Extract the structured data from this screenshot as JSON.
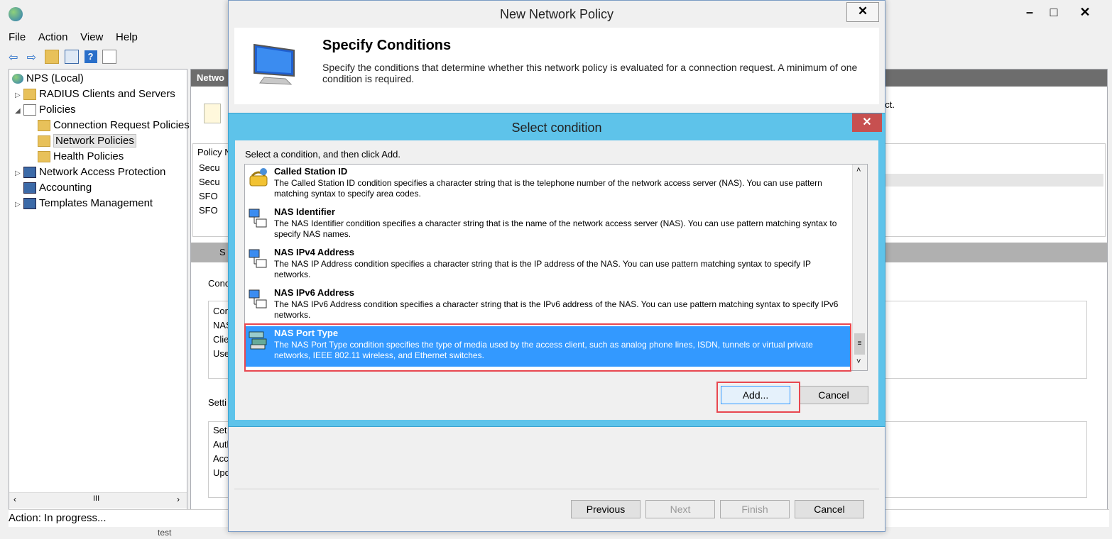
{
  "mmc": {
    "menu": [
      "File",
      "Action",
      "View",
      "Help"
    ],
    "tree": [
      {
        "label": "NPS (Local)"
      },
      {
        "label": "RADIUS Clients and Servers"
      },
      {
        "label": "Policies"
      },
      {
        "label": "Connection Request Policies"
      },
      {
        "label": "Network Policies"
      },
      {
        "label": "Health Policies"
      },
      {
        "label": "Network Access Protection"
      },
      {
        "label": "Accounting"
      },
      {
        "label": "Templates Management"
      }
    ],
    "right_pane": {
      "header_partial": "Netwo",
      "policy_col": "Policy N",
      "rows": [
        "Secu",
        "Secu",
        "SFO",
        "SFO"
      ],
      "selected_header_partial": "S",
      "conditions_label": "Cond",
      "conditions_rows": [
        "Con",
        "NAS",
        "Clie",
        "Use"
      ],
      "settings_label": "Setti",
      "settings_rows": [
        "Set",
        "Auth",
        "Acc",
        "Upd"
      ],
      "side_text": "ect."
    },
    "status": "Action:  In progress...",
    "bottom_partial": "test"
  },
  "wizard": {
    "title": "New Network Policy",
    "heading": "Specify Conditions",
    "description": "Specify the conditions that determine whether this network policy is evaluated for a connection request. A minimum of one condition is required.",
    "buttons": {
      "previous": "Previous",
      "next": "Next",
      "finish": "Finish",
      "cancel": "Cancel"
    }
  },
  "dialog": {
    "title": "Select condition",
    "instruction": "Select a condition, and then click Add.",
    "items": [
      {
        "name": "Called Station ID",
        "description": "The Called Station ID condition specifies a character string that is the telephone number of the network access server (NAS). You can use pattern matching syntax to specify area codes."
      },
      {
        "name": "NAS Identifier",
        "description": "The NAS Identifier condition specifies a character string that is the name of the network access server (NAS). You can use pattern matching syntax to specify NAS names."
      },
      {
        "name": "NAS IPv4 Address",
        "description": "The NAS IP Address condition specifies a character string that is the IP address of the NAS. You can use pattern matching syntax to specify IP networks."
      },
      {
        "name": "NAS IPv6 Address",
        "description": "The NAS IPv6 Address condition specifies a character string that is the IPv6 address of the NAS. You can use pattern matching syntax to specify IPv6 networks."
      },
      {
        "name": "NAS Port Type",
        "description": "The NAS Port Type condition specifies the type of media used by the access client, such as analog phone lines, ISDN, tunnels or virtual private networks, IEEE 802.11 wireless, and Ethernet switches."
      }
    ],
    "selected_index": 4,
    "buttons": {
      "add": "Add...",
      "cancel": "Cancel"
    },
    "colors": {
      "frame": "#5ec3ea",
      "selection": "#3399ff",
      "highlight": "#e8474f",
      "close": "#c75050"
    }
  }
}
